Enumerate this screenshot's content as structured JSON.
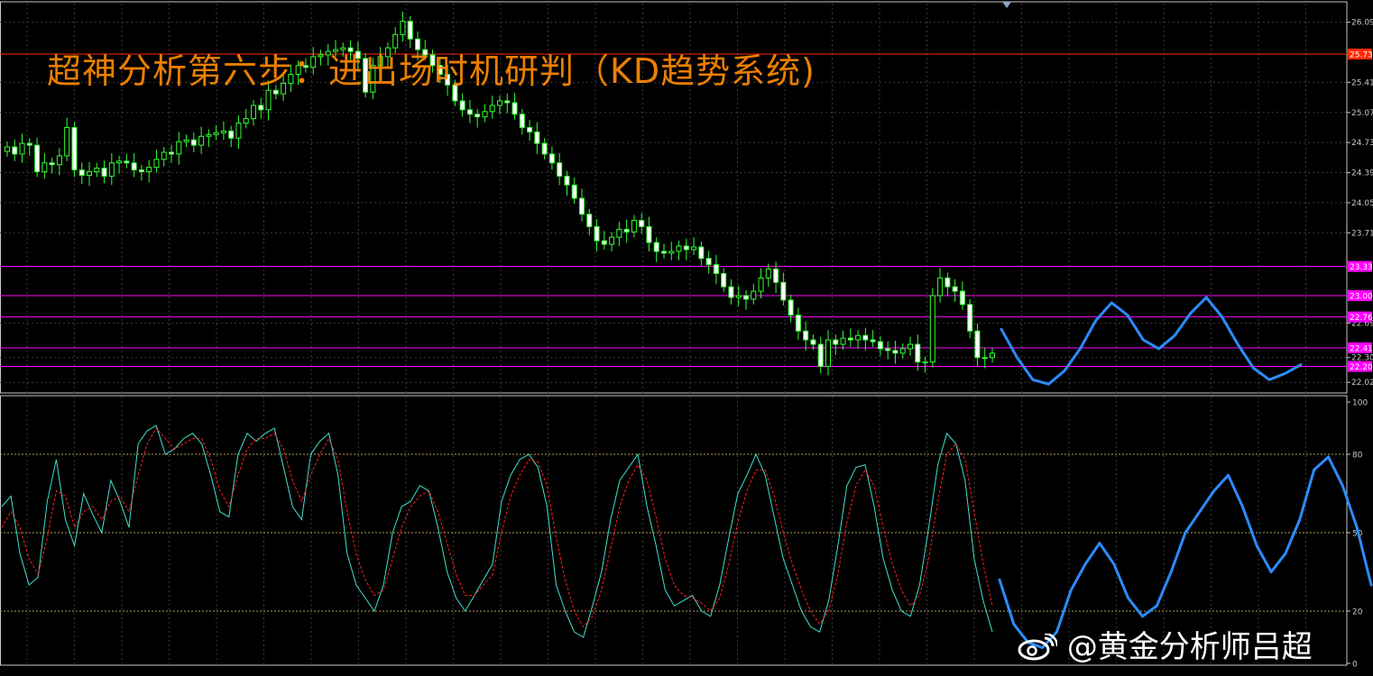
{
  "title": "超神分析第六步：进出场时机研判（KD趋势系统)",
  "watermark": "@黄金分析师吕超",
  "colors": {
    "background": "#000000",
    "grid": "#3a3a3a",
    "axis": "#c8c8c8",
    "bull_candle": "#33ff33",
    "resistance_red": "#ff2a00",
    "support_magenta": "#ff00ff",
    "k_line": "#40e0d0",
    "d_line": "#ff2020",
    "forecast": "#2a8cff",
    "level_dotted": "#b8a060",
    "title_orange": "#ff8a00"
  },
  "chart_data": [
    {
      "type": "candlestick",
      "title": "",
      "ylim": [
        21.9,
        26.3
      ],
      "y_ticks": [
        "26.09",
        "25.41",
        "25.07",
        "24.73",
        "24.39",
        "24.05",
        "23.71",
        "22.69",
        "22.30",
        "22.02"
      ],
      "y_tick_values": [
        26.09,
        25.41,
        25.07,
        24.73,
        24.39,
        24.05,
        23.71,
        22.69,
        22.3,
        22.02
      ],
      "horizontal_lines": [
        {
          "value": 25.73,
          "label": "25.73",
          "color": "#ff2a00"
        },
        {
          "value": 23.33,
          "label": "23.33",
          "color": "#ff00ff"
        },
        {
          "value": 23.0,
          "label": "23.00",
          "color": "#ff00ff"
        },
        {
          "value": 22.76,
          "label": "22.76",
          "color": "#ff00ff"
        },
        {
          "value": 22.41,
          "label": "22.41",
          "color": "#ff00ff"
        },
        {
          "value": 22.2,
          "label": "22.20",
          "color": "#ff00ff"
        }
      ],
      "close": [
        24.68,
        24.6,
        24.72,
        24.7,
        24.4,
        24.5,
        24.48,
        24.58,
        24.9,
        24.42,
        24.36,
        24.4,
        24.44,
        24.35,
        24.5,
        24.52,
        24.5,
        24.42,
        24.4,
        24.45,
        24.54,
        24.62,
        24.6,
        24.74,
        24.76,
        24.7,
        24.8,
        24.82,
        24.84,
        24.86,
        24.78,
        24.95,
        25.0,
        25.15,
        25.1,
        25.32,
        25.28,
        25.4,
        25.5,
        25.6,
        25.58,
        25.7,
        25.72,
        25.76,
        25.78,
        25.8,
        25.76,
        25.68,
        25.3,
        25.6,
        25.7,
        25.8,
        25.95,
        26.1,
        25.9,
        25.78,
        25.72,
        25.6,
        25.5,
        25.38,
        25.2,
        25.1,
        25.05,
        25.02,
        25.08,
        25.15,
        25.2,
        25.18,
        25.05,
        24.9,
        24.85,
        24.72,
        24.6,
        24.5,
        24.35,
        24.25,
        24.1,
        23.92,
        23.78,
        23.62,
        23.58,
        23.66,
        23.75,
        23.72,
        23.85,
        23.78,
        23.6,
        23.5,
        23.48,
        23.5,
        23.56,
        23.52,
        23.55,
        23.42,
        23.35,
        23.25,
        23.1,
        22.98,
        23.0,
        22.96,
        23.05,
        23.2,
        23.3,
        23.15,
        22.95,
        22.78,
        22.6,
        22.5,
        22.45,
        22.2,
        22.5,
        22.45,
        22.52,
        22.5,
        22.55,
        22.5,
        22.48,
        22.4,
        22.38,
        22.35,
        22.4,
        22.45,
        22.25,
        22.25,
        23.0,
        23.2,
        23.1,
        23.05,
        22.9,
        22.6,
        22.3,
        22.3,
        22.35
      ],
      "forecast": {
        "description": "",
        "values": [
          22.62,
          22.3,
          22.05,
          22.0,
          22.15,
          22.4,
          22.72,
          22.92,
          22.78,
          22.5,
          22.4,
          22.55,
          22.8,
          22.98,
          22.76,
          22.45,
          22.18,
          22.05,
          22.12,
          22.22
        ]
      }
    },
    {
      "type": "line",
      "title": "",
      "ylim": [
        0,
        100
      ],
      "y_ticks": [
        "100",
        "80",
        "50",
        "20",
        "0"
      ],
      "y_tick_values": [
        100,
        80,
        50,
        20,
        0
      ],
      "levels": [
        80,
        50,
        20
      ],
      "series": [
        {
          "key": "K",
          "values": [
            60,
            64,
            42,
            30,
            33,
            62,
            78,
            55,
            45,
            65,
            57,
            50,
            70,
            62,
            52,
            84,
            89,
            91,
            80,
            82,
            86,
            88,
            84,
            72,
            58,
            56,
            80,
            88,
            85,
            88,
            90,
            75,
            60,
            55,
            80,
            85,
            88,
            72,
            42,
            30,
            25,
            20,
            30,
            50,
            60,
            62,
            68,
            66,
            52,
            35,
            25,
            20,
            26,
            32,
            38,
            62,
            72,
            78,
            80,
            75,
            60,
            30,
            20,
            12,
            10,
            22,
            35,
            55,
            70,
            75,
            80,
            60,
            45,
            28,
            22,
            24,
            26,
            20,
            18,
            30,
            48,
            65,
            72,
            80,
            72,
            56,
            40,
            30,
            20,
            14,
            12,
            24,
            45,
            68,
            75,
            76,
            60,
            40,
            28,
            20,
            18,
            30,
            52,
            76,
            88,
            84,
            70,
            40,
            24,
            12
          ]
        },
        {
          "key": "D",
          "values": [
            52,
            58,
            52,
            40,
            34,
            48,
            66,
            64,
            52,
            58,
            60,
            55,
            62,
            64,
            58,
            72,
            84,
            90,
            86,
            82,
            84,
            86,
            86,
            78,
            66,
            60,
            72,
            82,
            86,
            86,
            88,
            82,
            70,
            62,
            72,
            80,
            86,
            78,
            58,
            42,
            32,
            26,
            28,
            40,
            52,
            60,
            64,
            66,
            58,
            46,
            34,
            26,
            26,
            30,
            34,
            50,
            64,
            72,
            78,
            77,
            68,
            48,
            32,
            20,
            14,
            18,
            28,
            44,
            60,
            70,
            76,
            70,
            56,
            40,
            30,
            26,
            25,
            23,
            20,
            25,
            38,
            54,
            66,
            74,
            74,
            64,
            50,
            38,
            28,
            20,
            15,
            20,
            34,
            54,
            68,
            74,
            68,
            52,
            38,
            28,
            22,
            26,
            40,
            62,
            80,
            84,
            78,
            58,
            38,
            22
          ]
        }
      ],
      "forecast": {
        "description": "",
        "values": [
          32,
          15,
          8,
          6,
          12,
          28,
          38,
          46,
          38,
          25,
          18,
          22,
          35,
          50,
          58,
          66,
          72,
          60,
          45,
          35,
          42,
          55,
          74,
          79,
          68,
          52,
          30
        ]
      }
    }
  ]
}
